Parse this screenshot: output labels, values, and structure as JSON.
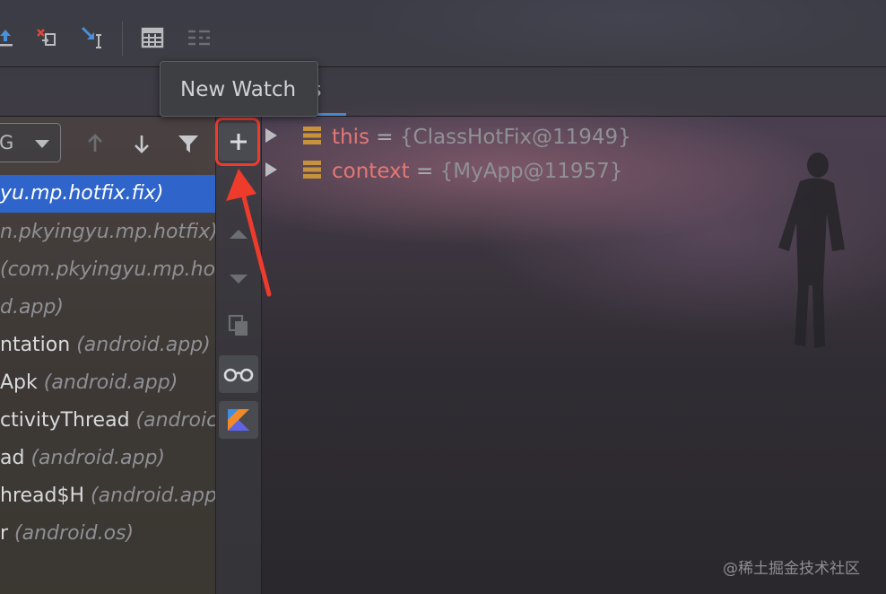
{
  "tooltip": {
    "text": "New Watch"
  },
  "tabs": {
    "visible_fragment": "s"
  },
  "frames": {
    "thread_selector_value": "G",
    "items": [
      {
        "method": "yu.mp.hotfix.fix)",
        "package": ""
      },
      {
        "method": "",
        "package": "n.pkyingyu.mp.hotfix)"
      },
      {
        "method": "",
        "package": "(com.pkyingyu.mp.ho"
      },
      {
        "method": "",
        "package": "d.app)"
      },
      {
        "method": "ntation ",
        "package": "(android.app)"
      },
      {
        "method": "Apk ",
        "package": "(android.app)"
      },
      {
        "method": "ctivityThread ",
        "package": "(androic"
      },
      {
        "method": "ad ",
        "package": "(android.app)"
      },
      {
        "method": "hread$H ",
        "package": "(android.app"
      },
      {
        "method": "r ",
        "package": "(android.os)"
      }
    ]
  },
  "variables": [
    {
      "name": "this",
      "eq": " = ",
      "value": "{ClassHotFix@11949}"
    },
    {
      "name": "context",
      "eq": " = ",
      "value": "{MyApp@11957}"
    }
  ],
  "watermark": "@稀土掘金技术社区",
  "icons": {
    "toolbar": [
      "step-out-icon",
      "drop-frame-icon",
      "run-to-cursor-icon",
      "evaluate-expression-icon",
      "trace-icon"
    ],
    "frames_header": [
      "up-arrow-icon",
      "down-arrow-icon",
      "filter-icon"
    ],
    "mid_toolbar": [
      "plus-icon",
      "up-icon",
      "down-icon",
      "copy-icon",
      "glasses-icon",
      "kotlin-icon"
    ]
  },
  "colors": {
    "selection": "#2f65ca",
    "highlight": "#ee3b2c",
    "var_name": "#e57775",
    "field_icon": "#c6923b",
    "tab_underline": "#4a88c7"
  }
}
